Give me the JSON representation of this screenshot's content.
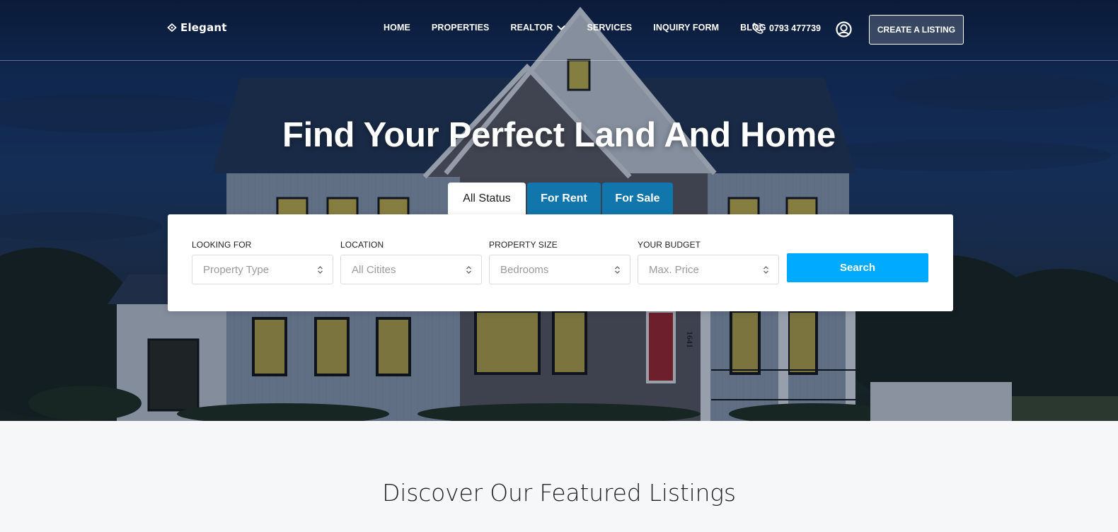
{
  "brand": {
    "name": "Elegant"
  },
  "nav": {
    "items": [
      {
        "label": "HOME"
      },
      {
        "label": "PROPERTIES"
      },
      {
        "label": "REALTOR",
        "has_dropdown": true
      },
      {
        "label": "SERVICES"
      },
      {
        "label": "INQUIRY FORM"
      },
      {
        "label": "BLOG"
      }
    ],
    "phone": "0793 477739",
    "create_listing": "CREATE A LISTING"
  },
  "hero": {
    "headline": "Find Your Perfect Land And Home",
    "house_number": "1641"
  },
  "tabs": [
    {
      "label": "All Status",
      "active": true
    },
    {
      "label": "For Rent",
      "active": false
    },
    {
      "label": "For Sale",
      "active": false
    }
  ],
  "search": {
    "fields": [
      {
        "label": "LOOKING FOR",
        "value": "Property Type"
      },
      {
        "label": "LOCATION",
        "value": "All Citites"
      },
      {
        "label": "PROPERTY SIZE",
        "value": "Bedrooms"
      },
      {
        "label": "YOUR BUDGET",
        "value": "Max. Price"
      }
    ],
    "button": "Search"
  },
  "featured": {
    "title": "Discover Our Featured Listings"
  },
  "colors": {
    "accent": "#00aaff",
    "tab_inactive": "#0a7db9",
    "hero_dark": "#0d1d3c"
  }
}
